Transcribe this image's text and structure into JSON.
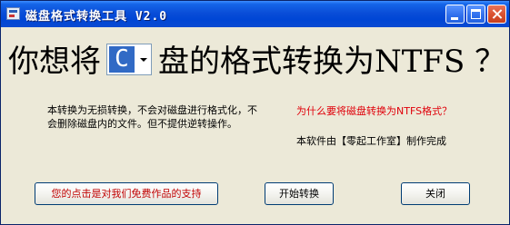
{
  "window": {
    "title": "磁盘格式转换工具 V2.0",
    "controls": {
      "minimize": "minimize",
      "maximize": "maximize",
      "close": "close"
    }
  },
  "headline": {
    "prefix": "你想将",
    "drive_letter": "C",
    "suffix": "盘的格式转换为NTFS ？"
  },
  "description": "本转换为无损转换，不会对磁盘进行格式化，不会删除磁盘内的文件。但不提供逆转操作。",
  "why_link": "为什么要将磁盘转换为NTFS格式？",
  "credit": "本软件由【零起工作室】制作完成",
  "buttons": {
    "support": "您的点击是对我们免费作品的支持",
    "convert": "开始转换",
    "close": "关闭"
  },
  "colors": {
    "titlebar": "#0046D5",
    "link_red": "#E0000A",
    "selection": "#316AC5",
    "window_bg": "#ECE9D8"
  },
  "icons": [
    "app-disk-icon",
    "minimize-icon",
    "maximize-icon",
    "close-icon",
    "dropdown-arrow-icon"
  ]
}
